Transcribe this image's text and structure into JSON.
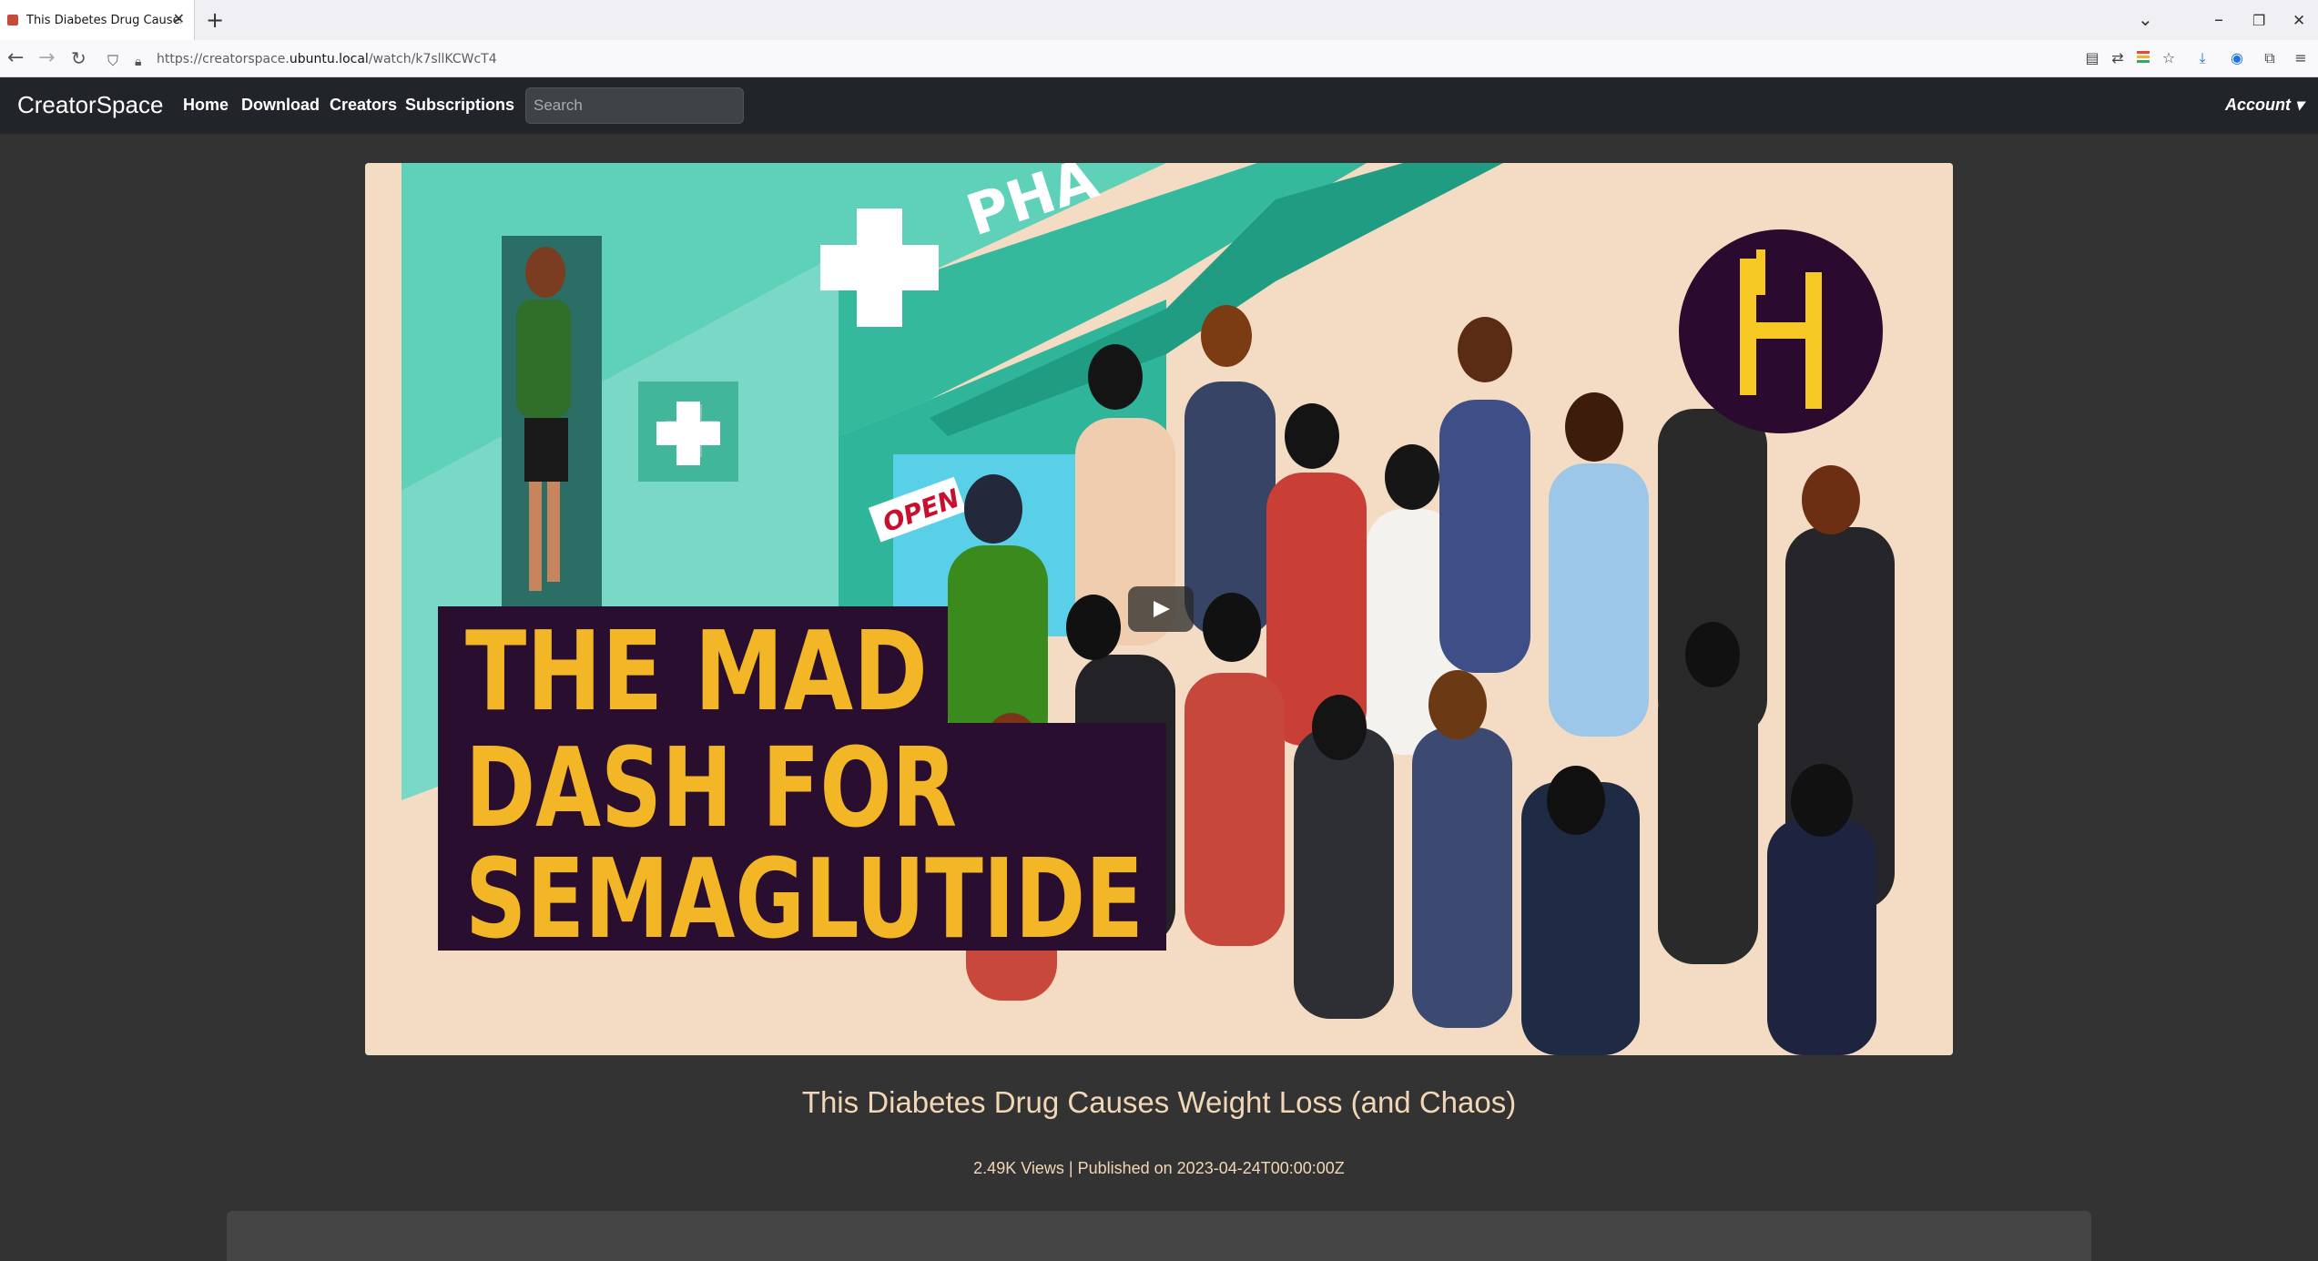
{
  "browser": {
    "tab_title": "This Diabetes Drug Causes Weig",
    "tab_close": "✕",
    "new_tab": "+",
    "url_prefix": "https://creatorspace.",
    "url_host": "ubuntu.local",
    "url_path": "/watch/k7sllKCWcT4",
    "window_controls": [
      "⌄",
      "–",
      "❐",
      "✕"
    ],
    "nav_icons": [
      "back-icon",
      "forward-icon",
      "reload-icon",
      "shield-icon",
      "lock-icon"
    ],
    "toolbar_icons": [
      "reader-icon",
      "translate-icon",
      "extension-color-icon",
      "star-icon",
      "download-icon",
      "account-circle-icon",
      "extensions-icon",
      "menu-icon"
    ]
  },
  "site": {
    "brand": "CreatorSpace",
    "nav": [
      "Home",
      "Download",
      "Creators",
      "Subscriptions"
    ],
    "search_placeholder": "Search",
    "account": "Account ▾"
  },
  "video": {
    "thumbnail_text_lines": [
      "THE MAD",
      "DASH FOR",
      "SEMAGLUTIDE"
    ],
    "sign_pharmacy": "PHA",
    "sign_open": "OPEN",
    "title": "This Diabetes Drug Causes Weight Loss (and Chaos)",
    "views": "2.49K Views",
    "published": "Published on 2023-04-24T00:00:00Z",
    "meta_separator": " | ",
    "colors": {
      "title_text": "#f1d7b5",
      "thumb_caption_bg": "#2a0e30",
      "thumb_caption_text": "#f2b627",
      "pharmacy_teal": "#3dc9b0"
    }
  }
}
